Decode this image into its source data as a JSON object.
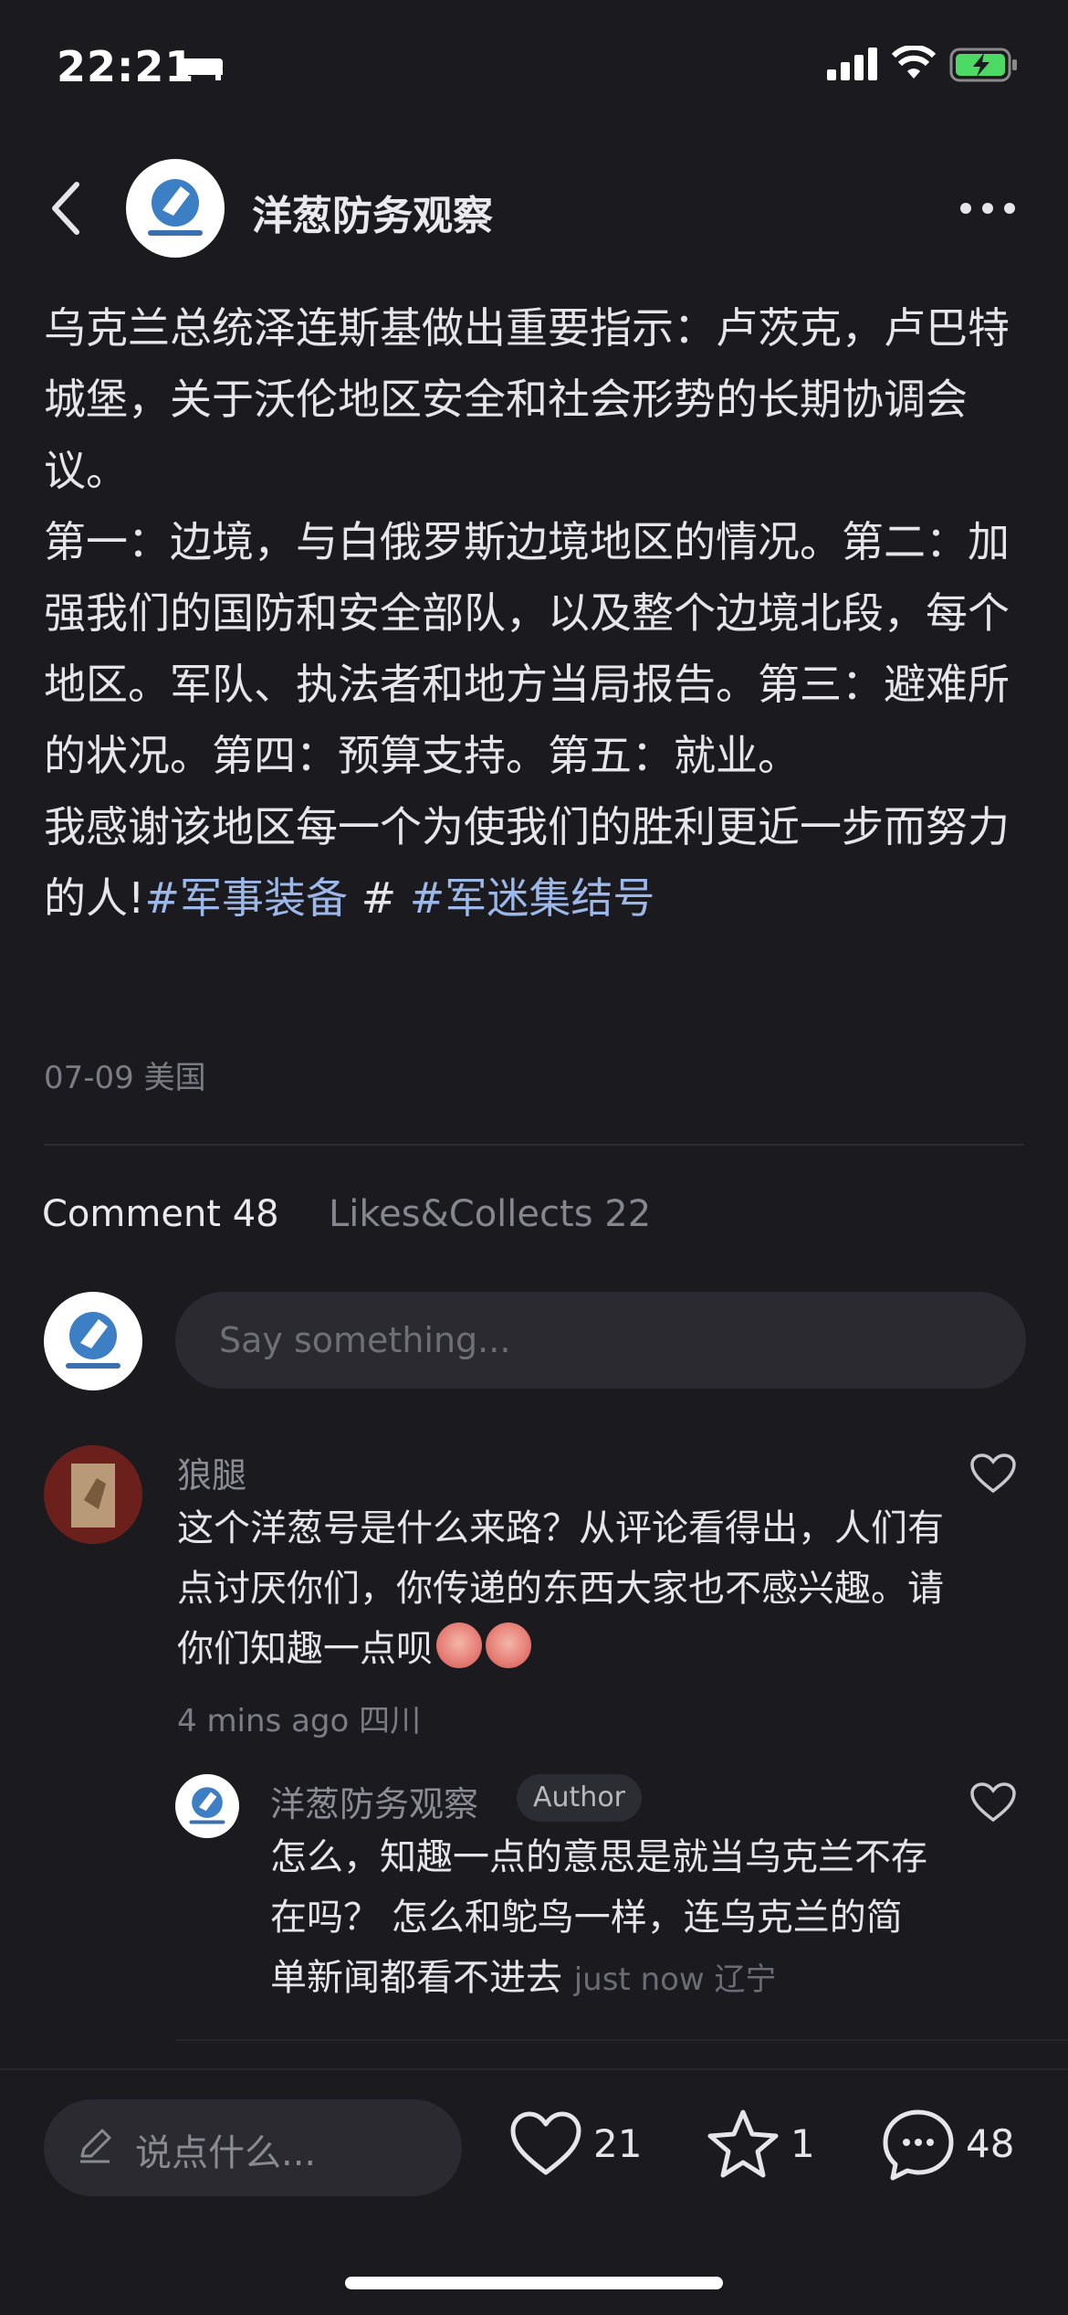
{
  "status_bar": {
    "time": "22:21"
  },
  "header": {
    "title": "洋葱防务观察"
  },
  "post": {
    "paragraphs": [
      "乌克兰总统泽连斯基做出重要指示：卢茨克，卢巴特城堡，关于沃伦地区安全和社会形势的长期协调会议。",
      "第一：边境，与白俄罗斯边境地区的情况。第二：加强我们的国防和安全部队，以及整个边境北段，每个地区。军队、执法者和地方当局报告。第三：避难所的状况。第四：预算支持。第五：就业。",
      "我感谢该地区每一个为使我们的胜利更近一步而努力的人!"
    ],
    "tags": [
      "#军事装备",
      "#",
      "#军迷集结号"
    ],
    "meta": "07-09 美国"
  },
  "tabs": {
    "comment": "Comment 48",
    "likes": "Likes&Collects 22"
  },
  "comment_input": {
    "placeholder": "Say something..."
  },
  "comments": [
    {
      "name": "狼腿",
      "text": "这个洋葱号是什么来路？从评论看得出，人们有点讨厌你们，你传递的东西大家也不感兴趣。请你们知趣一点呗",
      "meta": "4 mins ago 四川",
      "reply": {
        "name": "洋葱防务观察",
        "badge": "Author",
        "text": "怎么，知趣一点的意思是就当乌克兰不存在吗？ 怎么和鸵鸟一样，连乌克兰的简单新闻都看不进去",
        "time": "just now 辽宁"
      }
    }
  ],
  "bottom_bar": {
    "input_placeholder": "说点什么...",
    "likes": "21",
    "collects": "1",
    "comments": "48"
  }
}
